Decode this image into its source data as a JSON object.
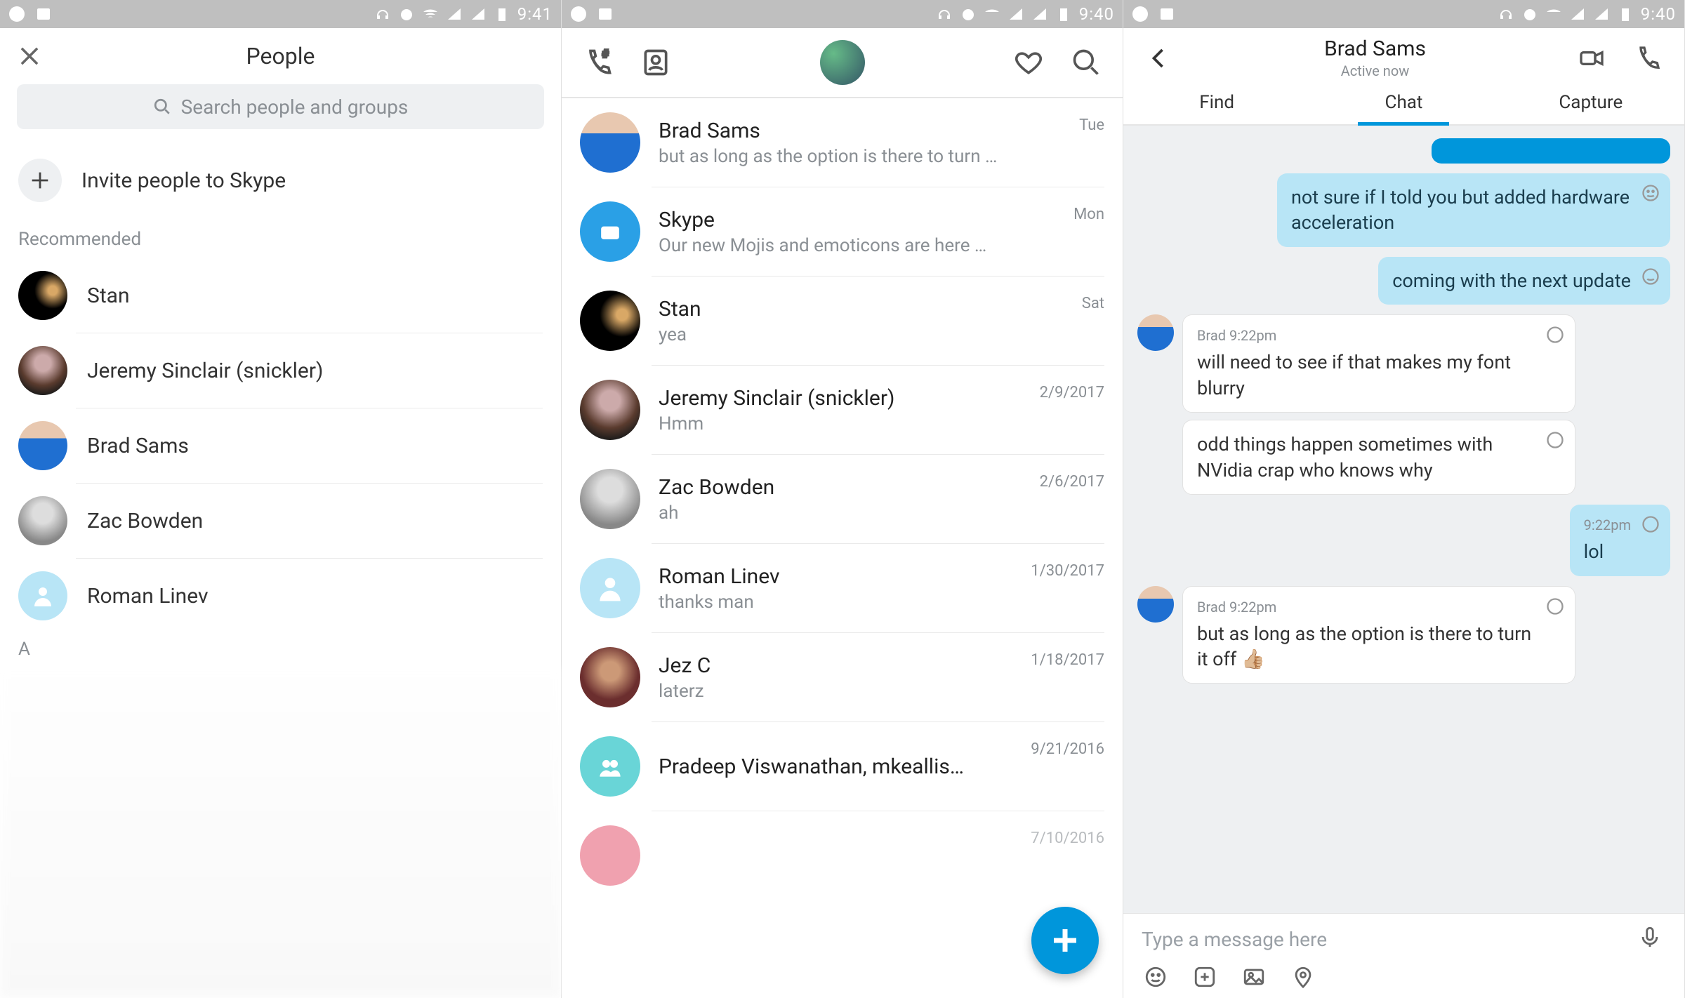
{
  "statusbar": {
    "time1": "9:41",
    "time2": "9:40",
    "time3": "9:40"
  },
  "people": {
    "title": "People",
    "search_placeholder": "Search people and groups",
    "invite_label": "Invite people to Skype",
    "recommended_label": "Recommended",
    "alpha_header": "A",
    "contacts": [
      {
        "name": "Stan"
      },
      {
        "name": "Jeremy Sinclair (snickler)"
      },
      {
        "name": "Brad Sams"
      },
      {
        "name": "Zac Bowden"
      },
      {
        "name": "Roman Linev"
      }
    ]
  },
  "recents": [
    {
      "name": "Brad Sams",
      "preview": "but as long as the option is there to turn …",
      "time": "Tue"
    },
    {
      "name": "Skype",
      "preview": "Our new Mojis and emoticons are here …",
      "time": "Mon"
    },
    {
      "name": "Stan",
      "preview": "yea",
      "time": "Sat"
    },
    {
      "name": "Jeremy Sinclair (snickler)",
      "preview": "Hmm",
      "time": "2/9/2017"
    },
    {
      "name": "Zac Bowden",
      "preview": "ah",
      "time": "2/6/2017"
    },
    {
      "name": "Roman Linev",
      "preview": "thanks man",
      "time": "1/30/2017"
    },
    {
      "name": "Jez C",
      "preview": "laterz",
      "time": "1/18/2017"
    },
    {
      "name": "Pradeep Viswanathan, mkeallis…",
      "preview": "",
      "time": "9/21/2016"
    }
  ],
  "recents_extra_time": "7/10/2016",
  "chat": {
    "title": "Brad Sams",
    "subtitle": "Active now",
    "tabs": {
      "find": "Find",
      "chat": "Chat",
      "capture": "Capture"
    },
    "messages": [
      {
        "side": "me",
        "text": "not sure if I told you but added hardware acceleration"
      },
      {
        "side": "me",
        "text": "coming with the next update"
      },
      {
        "side": "them",
        "meta": "Brad 9:22pm",
        "text": "will need to see if that makes my font blurry"
      },
      {
        "side": "them",
        "text": "odd things happen sometimes with NVidia crap who knows why"
      },
      {
        "side": "me",
        "meta": "9:22pm",
        "text": "lol"
      },
      {
        "side": "them",
        "meta": "Brad 9:22pm",
        "text": "but as long as the option is there to turn it off 👍🏼"
      }
    ],
    "input_placeholder": "Type a message here"
  }
}
